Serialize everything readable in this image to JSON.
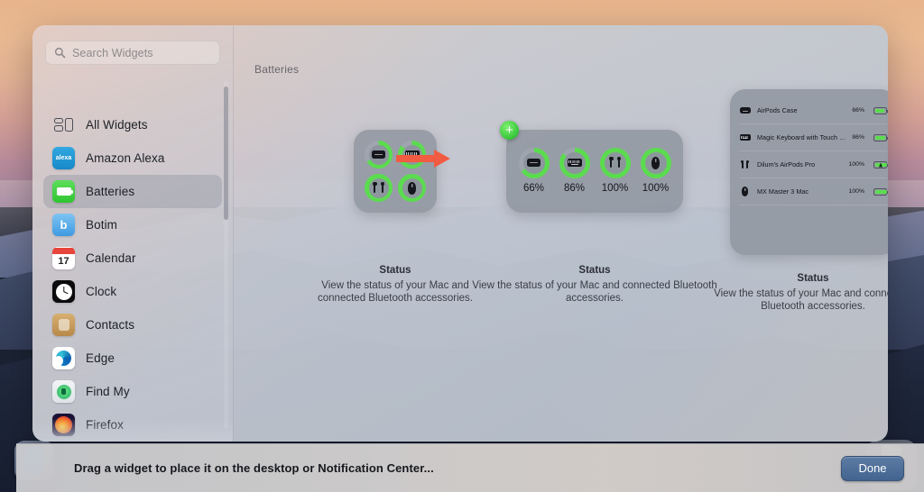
{
  "window": {
    "content_title": "Batteries"
  },
  "search": {
    "placeholder": "Search Widgets",
    "value": "",
    "icon": "search-icon"
  },
  "sidebar": {
    "items": [
      {
        "label": "All Widgets",
        "icon": "all-widgets-icon",
        "selected": false
      },
      {
        "label": "Amazon Alexa",
        "icon": "amazon-alexa-icon",
        "selected": false
      },
      {
        "label": "Batteries",
        "icon": "batteries-icon",
        "selected": true
      },
      {
        "label": "Botim",
        "icon": "botim-icon",
        "selected": false
      },
      {
        "label": "Calendar",
        "icon": "calendar-icon",
        "selected": false
      },
      {
        "label": "Clock",
        "icon": "clock-icon",
        "selected": false
      },
      {
        "label": "Contacts",
        "icon": "contacts-icon",
        "selected": false
      },
      {
        "label": "Edge",
        "icon": "edge-icon",
        "selected": false
      },
      {
        "label": "Find My",
        "icon": "find-my-icon",
        "selected": false
      },
      {
        "label": "Firefox",
        "icon": "firefox-icon",
        "selected": false
      },
      {
        "label": "",
        "icon": "google-icon",
        "selected": false
      }
    ],
    "calendar_day": "17",
    "calendar_month": "JUL",
    "alexa_wordmark": "alexa",
    "botim_letter": "b"
  },
  "previews": {
    "small": {
      "size_name": "small",
      "caption_title": "Status",
      "caption_desc": "View the status of your Mac and connected Bluetooth accessories.",
      "cells": [
        {
          "device": "airpods-case-icon",
          "percent": 66
        },
        {
          "device": "keyboard-icon",
          "percent": 86
        },
        {
          "device": "airpods-icon",
          "percent": 100
        },
        {
          "device": "mouse-icon",
          "percent": 100
        }
      ]
    },
    "medium": {
      "size_name": "medium",
      "caption_title": "Status",
      "caption_desc": "View the status of your Mac and connected Bluetooth accessories.",
      "cells": [
        {
          "device": "airpods-case-icon",
          "percent": 66,
          "label": "66%"
        },
        {
          "device": "keyboard-icon",
          "percent": 86,
          "label": "86%"
        },
        {
          "device": "airpods-icon",
          "percent": 100,
          "label": "100%"
        },
        {
          "device": "mouse-icon",
          "percent": 100,
          "label": "100%"
        }
      ],
      "add_button_label": "+"
    },
    "large": {
      "size_name": "large",
      "caption_title": "Status",
      "caption_desc": "View the status of your Mac and connected Bluetooth accessories.",
      "rows": [
        {
          "device": "airpods-case-icon",
          "name": "AirPods Case",
          "percent": "66%",
          "fill": 66,
          "charging": false
        },
        {
          "device": "keyboard-icon",
          "name": "Magic Keyboard with Touch ID and Nu...",
          "percent": "86%",
          "fill": 86,
          "charging": false
        },
        {
          "device": "airpods-icon",
          "name": "Dilum's AirPods Pro",
          "percent": "100%",
          "fill": 100,
          "charging": true
        },
        {
          "device": "mouse-icon",
          "name": "MX Master 3 Mac",
          "percent": "100%",
          "fill": 100,
          "charging": false
        }
      ]
    }
  },
  "annotation": {
    "type": "arrow",
    "color": "#f15b41",
    "points_to": "add-widget-plus-button"
  },
  "bottom_bar": {
    "hint": "Drag a widget to place it on the desktop or Notification Center...",
    "done_label": "Done"
  },
  "colors": {
    "accent_green": "#5bdc4f",
    "annotation_red": "#f15b41",
    "done_blue": "#4f6f9b"
  }
}
